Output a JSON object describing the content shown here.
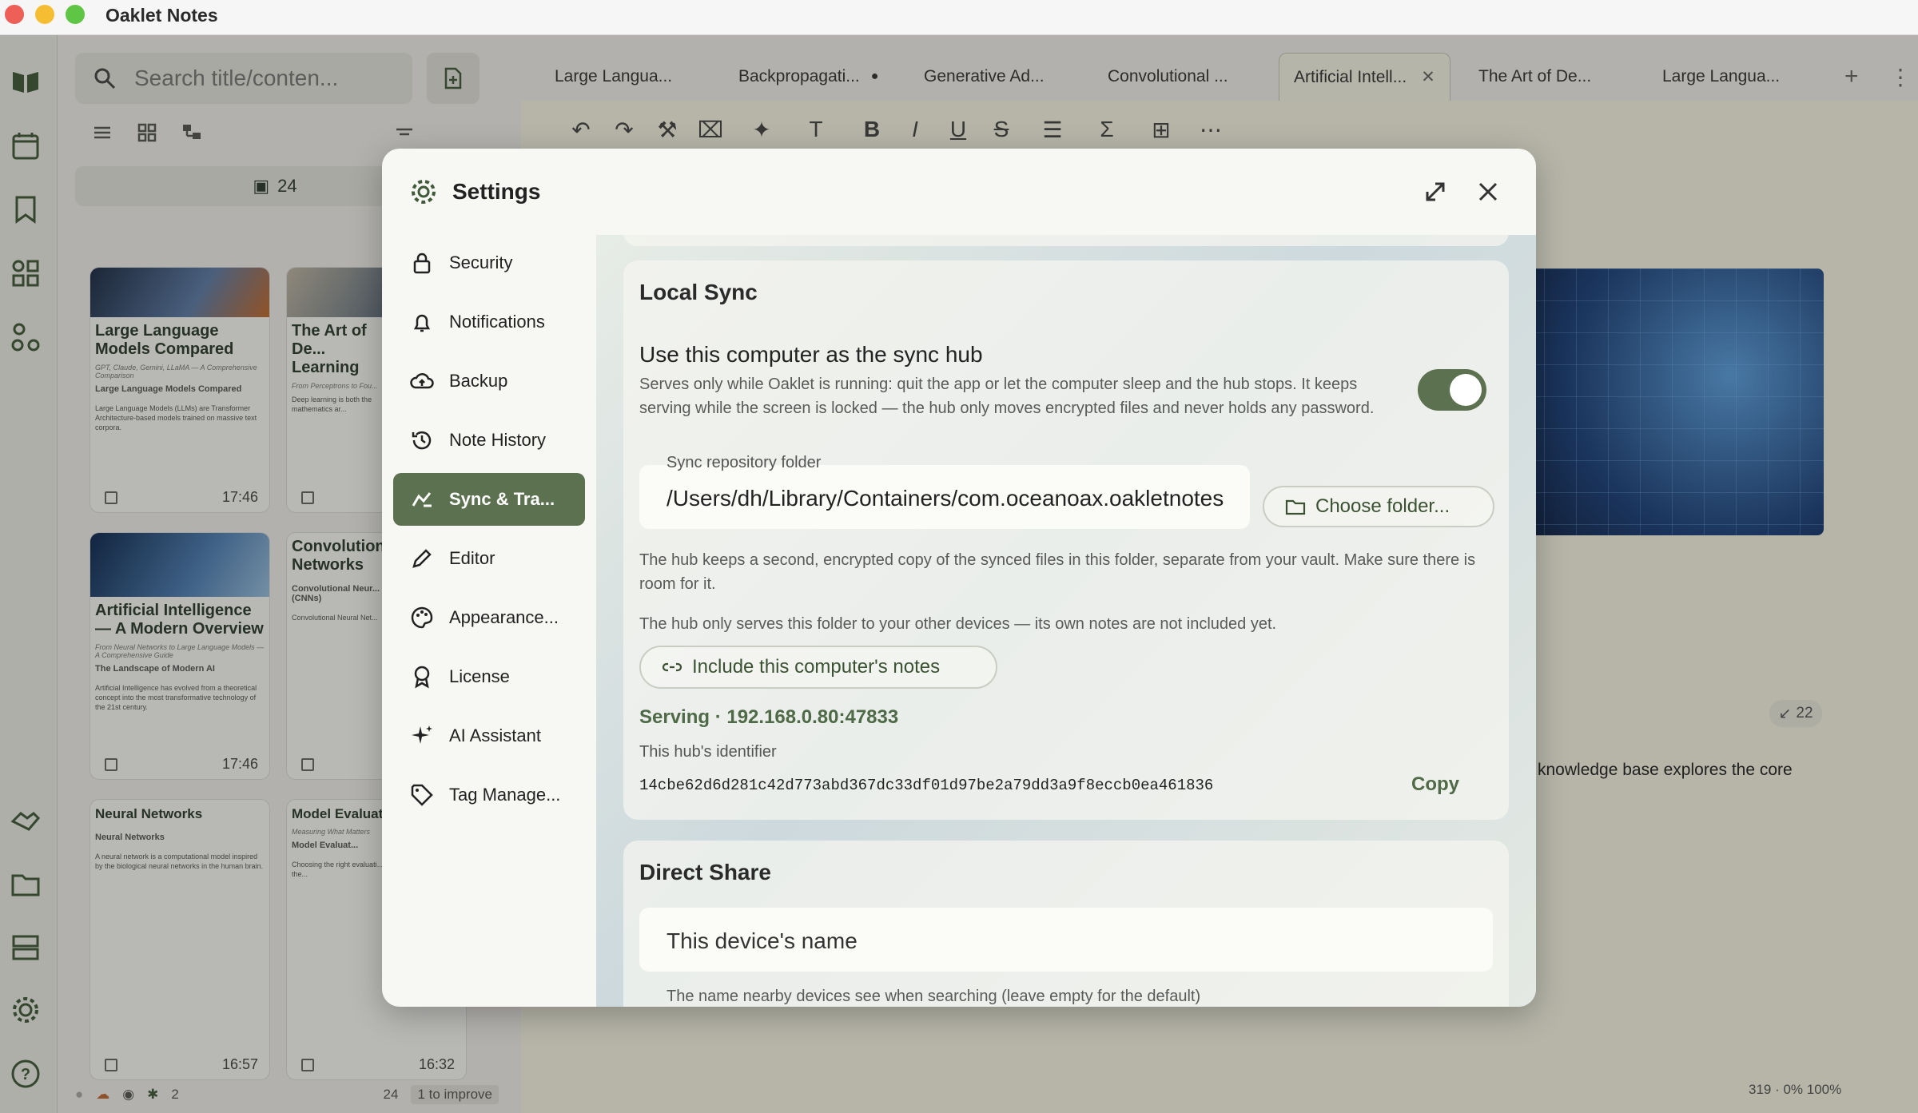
{
  "app": {
    "title": "Oaklet Notes"
  },
  "search": {
    "placeholder": "Search title/conten..."
  },
  "notelist": {
    "date_count": "24",
    "cards": [
      {
        "title": "Large Language Models Compared",
        "subtitle": "GPT, Claude, Gemini, LLaMA — A Comprehensive Comparison",
        "heading": "Large Language Models Compared",
        "body": "Large Language Models (LLMs) are Transformer Architecture-based models trained on massive text corpora.",
        "time": "17:46"
      },
      {
        "title": "The Art of De... Learning",
        "subtitle": "From Perceptrons to Fou...",
        "heading": "",
        "body": "Deep learning is both the mathematics ar...",
        "time": ""
      },
      {
        "title": "Artificial Intelligence — A Modern Overview",
        "subtitle": "From Neural Networks to Large Language Models — A Comprehensive Guide",
        "heading": "The Landscape of Modern AI",
        "body": "Artificial Intelligence has evolved from a theoretical concept into the most transformative technology of the 21st century.",
        "time": "17:46"
      },
      {
        "title": "Convolutional Networks",
        "subtitle": "",
        "heading": "Convolutional Neur... (CNNs)",
        "body": "Convolutional Neural Net...",
        "time": ""
      },
      {
        "title": "Neural Networks",
        "subtitle": "",
        "heading": "Neural Networks",
        "body": "A neural network is a computational model inspired by the biological neural networks in the human brain.",
        "time": "16:57"
      },
      {
        "title": "Model Evaluat...",
        "subtitle": "Measuring What Matters",
        "heading": "Model Evaluat...",
        "body": "Choosing the right evaluati... important as choosing the...",
        "time": "16:32"
      }
    ],
    "status": {
      "count": "24",
      "improve": "1 to improve",
      "devices": "2"
    }
  },
  "tabs": [
    {
      "label": "Large Langua...",
      "dirty": false,
      "active": false
    },
    {
      "label": "Backpropagati...",
      "dirty": true,
      "active": false
    },
    {
      "label": "Generative Ad...",
      "dirty": false,
      "active": false
    },
    {
      "label": "Convolutional ...",
      "dirty": false,
      "active": false
    },
    {
      "label": "Artificial Intell...",
      "dirty": false,
      "active": true
    },
    {
      "label": "The Art of De...",
      "dirty": false,
      "active": false
    },
    {
      "label": "Large Langua...",
      "dirty": false,
      "active": false
    }
  ],
  "editor": {
    "snippet": "knowledge base explores the core",
    "backlinks": "22",
    "footer": "319 · 0%      100%"
  },
  "settings": {
    "title": "Settings",
    "nav": [
      {
        "label": "Security",
        "icon": "lock-icon"
      },
      {
        "label": "Notifications",
        "icon": "bell-icon"
      },
      {
        "label": "Backup",
        "icon": "cloud-upload-icon"
      },
      {
        "label": "Note History",
        "icon": "history-icon"
      },
      {
        "label": "Sync & Tra...",
        "icon": "sync-icon",
        "active": true
      },
      {
        "label": "Editor",
        "icon": "pencil-icon"
      },
      {
        "label": "Appearance...",
        "icon": "palette-icon"
      },
      {
        "label": "License",
        "icon": "badge-icon"
      },
      {
        "label": "AI Assistant",
        "icon": "sparkle-icon"
      },
      {
        "label": "Tag Manage...",
        "icon": "tag-icon"
      }
    ],
    "local_sync": {
      "title": "Local Sync",
      "hub_title": "Use this computer as the sync hub",
      "hub_desc": "Serves only while Oaklet is running: quit the app or let the computer sleep and the hub stops. It keeps serving while the screen is locked — the hub only moves encrypted files and never holds any password.",
      "hub_enabled": true,
      "folder_label": "Sync repository folder",
      "folder_value": "/Users/dh/Library/Containers/com.oceanoax.oakletnotes",
      "choose_folder": "Choose folder...",
      "folder_note": "The hub keeps a second, encrypted copy of the synced files in this folder, separate from your vault. Make sure there is room for it.",
      "serve_note": "The hub only serves this folder to your other devices — its own notes are not included yet.",
      "include_button": "Include this computer's notes",
      "serving": "Serving · 192.168.0.80:47833",
      "hub_id_label": "This hub's identifier",
      "hub_id": "14cbe62d6d281c42d773abd367dc33df01d97be2a79dd3a9f8eccb0ea461836",
      "copy": "Copy"
    },
    "direct_share": {
      "title": "Direct Share",
      "device_name_placeholder": "This device's name",
      "device_name_help": "The name nearby devices see when searching (leave empty for the default)"
    }
  },
  "colors": {
    "accent": "#5c7150",
    "accent_text": "#4e6a46"
  }
}
